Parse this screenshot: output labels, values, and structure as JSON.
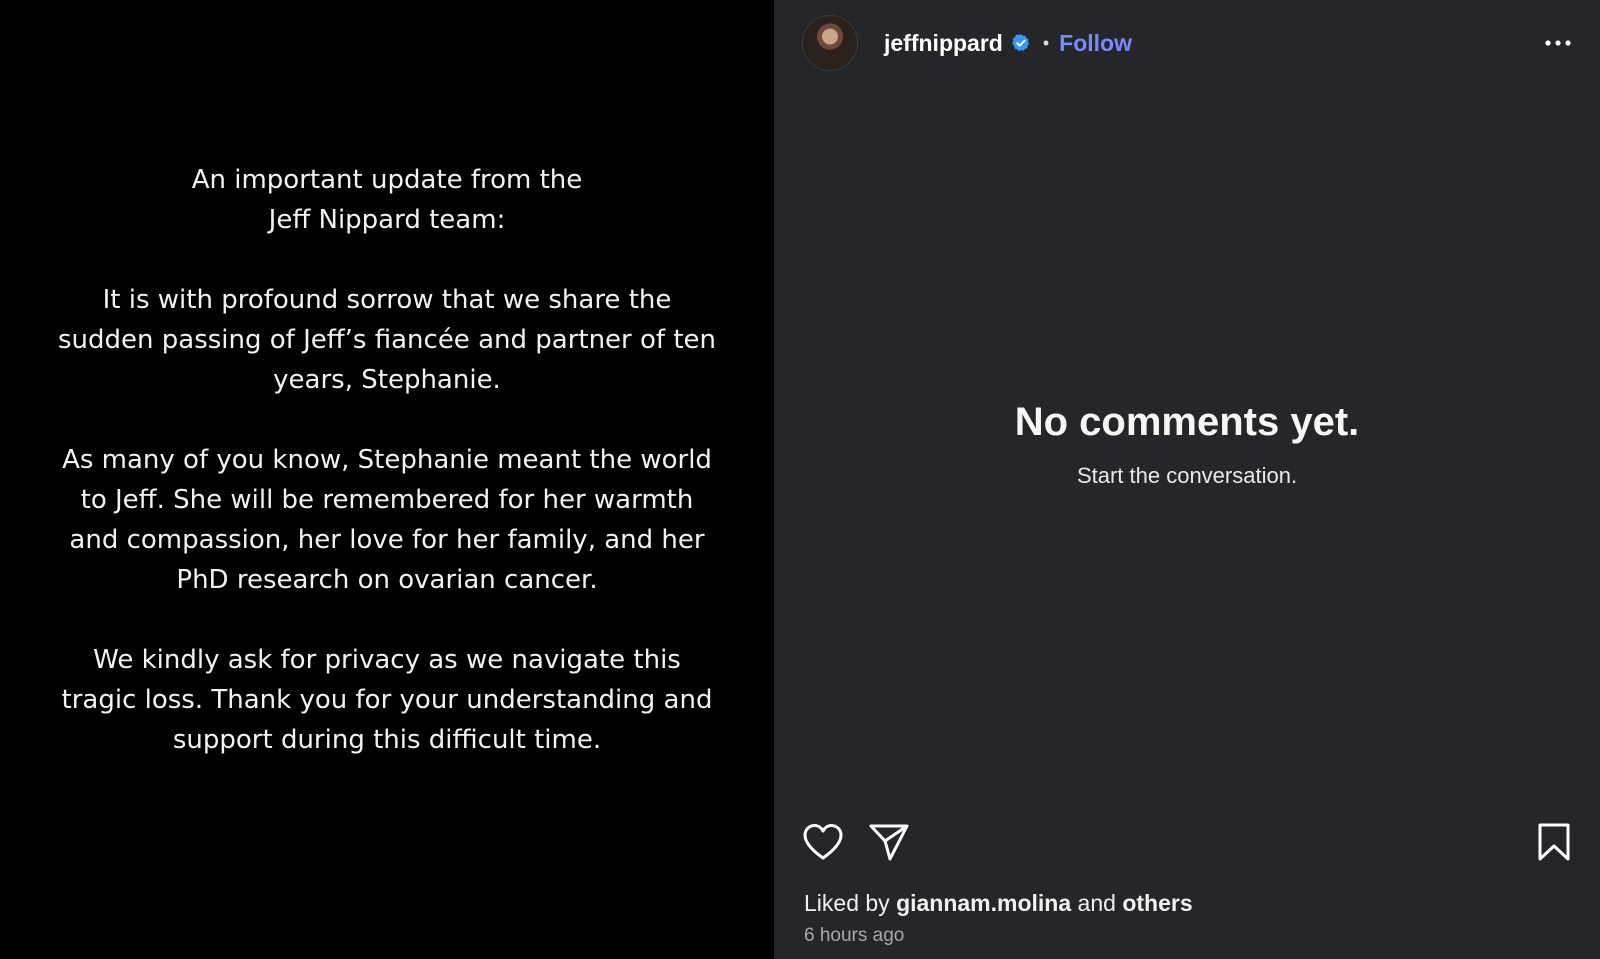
{
  "post": {
    "heading_lines": [
      "An important update from the",
      "Jeff Nippard team:"
    ],
    "paragraphs": [
      "It is with profound sorrow that we share the sudden passing of Jeff’s fiancée and partner of ten years, Stephanie.",
      "As many of you know, Stephanie meant the world to Jeff. She will be remembered for her warmth and compassion, her love for her family, and her PhD research on ovarian cancer.",
      "We kindly ask for privacy as we navigate this tragic loss. Thank you for your understanding and support during this difficult time."
    ]
  },
  "header": {
    "username": "jeffnippard",
    "separator": "•",
    "follow_label": "Follow",
    "avatar_icon": "profile-avatar",
    "verified_icon": "verified-badge-icon",
    "more_icon": "more-options-icon"
  },
  "comments": {
    "empty_title": "No comments yet.",
    "empty_subtitle": "Start the conversation."
  },
  "actions": {
    "like_icon": "heart-icon",
    "share_icon": "paper-plane-icon",
    "save_icon": "bookmark-icon"
  },
  "likes": {
    "prefix": "Liked by",
    "user": "giannam.molina",
    "conjunction": "and",
    "others": "others"
  },
  "timestamp": "6 hours ago",
  "colors": {
    "panel_bg": "#25262a",
    "image_bg": "#000000",
    "follow": "#7b87ff",
    "verified": "#3897f0"
  }
}
